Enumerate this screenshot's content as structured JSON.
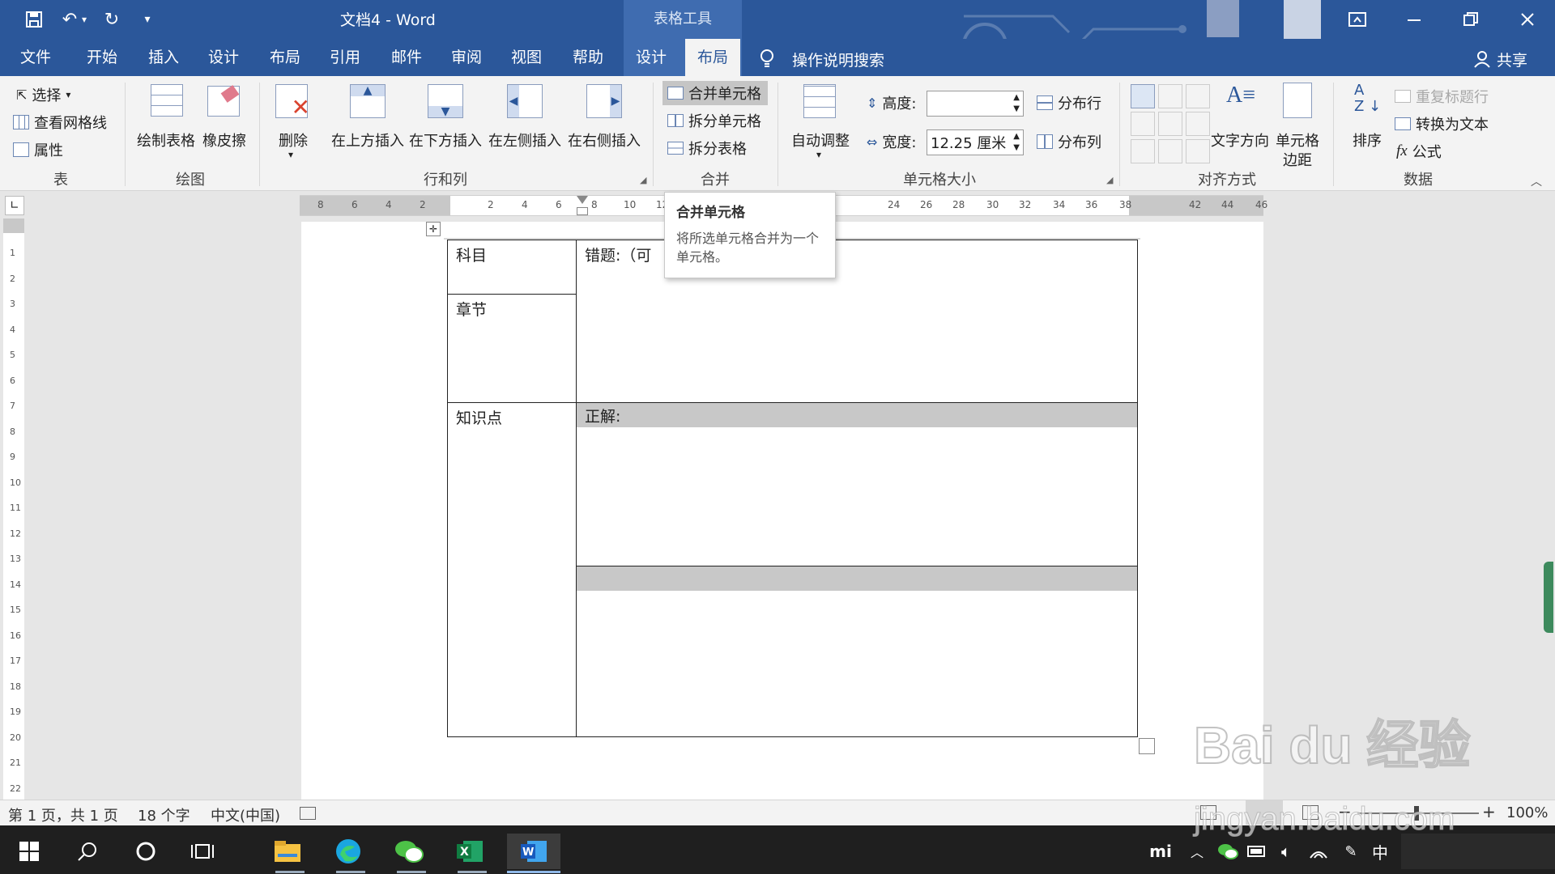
{
  "window": {
    "title": "文档4  -  Word",
    "context_title": "表格工具"
  },
  "tabs": [
    "文件",
    "开始",
    "插入",
    "设计",
    "布局",
    "引用",
    "邮件",
    "审阅",
    "视图",
    "帮助",
    "设计",
    "布局"
  ],
  "search": "操作说明搜索",
  "share": "共享",
  "ribbon": {
    "table": {
      "select": "选择",
      "gridlines": "查看网格线",
      "properties": "属性",
      "label": "表"
    },
    "draw": {
      "draw_table": "绘制表格",
      "eraser": "橡皮擦",
      "label": "绘图"
    },
    "rows_cols": {
      "delete": "删除",
      "insert_above": "在上方插入",
      "insert_below": "在下方插入",
      "insert_left": "在左侧插入",
      "insert_right": "在右侧插入",
      "label": "行和列"
    },
    "merge": {
      "merge_cells": "合并单元格",
      "split_cells": "拆分单元格",
      "split_table": "拆分表格",
      "label": "合并"
    },
    "cell_size": {
      "autofit": "自动调整",
      "height_label": "高度:",
      "height_value": "",
      "width_label": "宽度:",
      "width_value": "12.25 厘米",
      "distribute_rows": "分布行",
      "distribute_cols": "分布列",
      "label": "单元格大小"
    },
    "alignment": {
      "text_direction": "文字方向",
      "cell_margins_1": "单元格",
      "cell_margins_2": "边距",
      "label": "对齐方式"
    },
    "data": {
      "sort": "排序",
      "repeat_header": "重复标题行",
      "convert_text": "转换为文本",
      "formula": "公式",
      "label": "数据"
    }
  },
  "tooltip": {
    "title": "合并单元格",
    "body": "将所选单元格合并为一个单元格。"
  },
  "ruler": {
    "h_ticks": [
      "8",
      "6",
      "4",
      "2",
      "2",
      "4",
      "6",
      "8",
      "10",
      "12",
      "24",
      "26",
      "28",
      "30",
      "32",
      "34",
      "36",
      "38",
      "42",
      "44",
      "46"
    ],
    "v_ticks": [
      "1",
      "2",
      "3",
      "4",
      "5",
      "6",
      "7",
      "8",
      "9",
      "10",
      "11",
      "12",
      "13",
      "14",
      "15",
      "16",
      "17",
      "18",
      "19",
      "20",
      "21",
      "22"
    ]
  },
  "document": {
    "subject": "科目",
    "chapter": "章节",
    "knowledge": "知识点",
    "wrong": "错题:（可",
    "correct": "正解:"
  },
  "status": {
    "page": "第 1 页，共 1 页",
    "words": "18 个字",
    "lang": "中文(中国)",
    "zoom": "100%"
  },
  "taskbar": {
    "ime": "中"
  },
  "watermark": {
    "logo": "Bai du 经验",
    "url": "jingyan.baidu.com"
  },
  "colors": {
    "brand": "#2b579a",
    "shade": "#c8c8c8"
  }
}
